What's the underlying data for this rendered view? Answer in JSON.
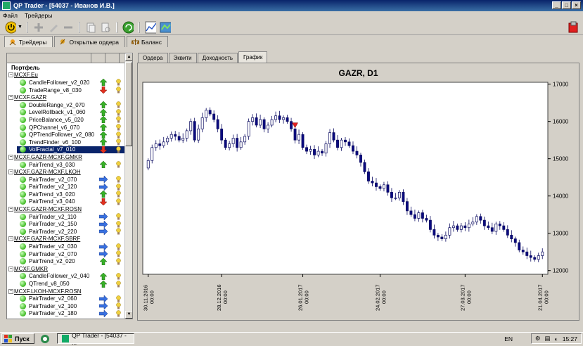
{
  "window": {
    "title": "QP Trader - [54037 - Иванов И.В.]"
  },
  "menu": [
    "Файл",
    "Трейдеры"
  ],
  "main_tabs": [
    {
      "label": "Трейдеры"
    },
    {
      "label": "Открытые ордера"
    },
    {
      "label": "Баланс"
    }
  ],
  "tree": [
    {
      "type": "root",
      "name": "Портфель"
    },
    {
      "type": "group",
      "name": "MCXF.Eu"
    },
    {
      "type": "item",
      "name": "CandleFollower_v2_020",
      "dir": "up"
    },
    {
      "type": "item",
      "name": "TradeRange_v8_030",
      "dir": "down"
    },
    {
      "type": "group",
      "name": "MCXF.GAZR"
    },
    {
      "type": "item",
      "name": "DoubleRange_v2_070",
      "dir": "up"
    },
    {
      "type": "item",
      "name": "LevelRollback_v1_060",
      "dir": "up"
    },
    {
      "type": "item",
      "name": "PriceBalance_v5_020",
      "dir": "up"
    },
    {
      "type": "item",
      "name": "QPChannel_v6_070",
      "dir": "up"
    },
    {
      "type": "item",
      "name": "QPTrendFollower_v2_080",
      "dir": "up"
    },
    {
      "type": "item",
      "name": "TrendFinder_v6_100",
      "dir": "up"
    },
    {
      "type": "item",
      "name": "VolFractal_v7_010",
      "dir": "down",
      "selected": true
    },
    {
      "type": "group",
      "name": "MCXF.GAZR-MCXF.GMKR"
    },
    {
      "type": "item",
      "name": "PairTrend_v3_030",
      "dir": "up"
    },
    {
      "type": "group",
      "name": "MCXF.GAZR-MCXF.LKOH"
    },
    {
      "type": "item",
      "name": "PairTrader_v2_070",
      "dir": "right"
    },
    {
      "type": "item",
      "name": "PairTrader_v2_120",
      "dir": "right"
    },
    {
      "type": "item",
      "name": "PairTrend_v3_020",
      "dir": "up"
    },
    {
      "type": "item",
      "name": "PairTrend_v3_040",
      "dir": "down"
    },
    {
      "type": "group",
      "name": "MCXF.GAZR-MCXF.ROSN"
    },
    {
      "type": "item",
      "name": "PairTrader_v2_110",
      "dir": "right"
    },
    {
      "type": "item",
      "name": "PairTrader_v2_150",
      "dir": "right"
    },
    {
      "type": "item",
      "name": "PairTrader_v2_220",
      "dir": "right"
    },
    {
      "type": "group",
      "name": "MCXF.GAZR-MCXF.SBRF"
    },
    {
      "type": "item",
      "name": "PairTrader_v2_030",
      "dir": "right"
    },
    {
      "type": "item",
      "name": "PairTrader_v2_070",
      "dir": "right"
    },
    {
      "type": "item",
      "name": "PairTrend_v2_020",
      "dir": "up"
    },
    {
      "type": "group",
      "name": "MCXF.GMKR"
    },
    {
      "type": "item",
      "name": "CandleFollower_v2_040",
      "dir": "up"
    },
    {
      "type": "item",
      "name": "QTrend_v8_050",
      "dir": "up"
    },
    {
      "type": "group",
      "name": "MCXF.LKOH-MCXF.ROSN"
    },
    {
      "type": "item",
      "name": "PairTrader_v2_060",
      "dir": "right"
    },
    {
      "type": "item",
      "name": "PairTrader_v2_100",
      "dir": "right"
    },
    {
      "type": "item",
      "name": "PairTrader_v2_180",
      "dir": "right"
    }
  ],
  "sub_tabs": [
    {
      "label": "Ордера"
    },
    {
      "label": "Эквити"
    },
    {
      "label": "Доходность"
    },
    {
      "label": "График",
      "active": true
    }
  ],
  "chart_data": {
    "type": "candlestick",
    "title": "GAZR, D1",
    "yticks": [
      12000,
      13000,
      14000,
      15000,
      16000,
      17000
    ],
    "ylim": [
      11900,
      17050
    ],
    "xticks": [
      "30.11.2016 00:00",
      "28.12.2016 00:00",
      "26.01.2017 00:00",
      "24.02.2017 00:00",
      "27.03.2017 00:00",
      "21.04.2017 00:00"
    ],
    "close": [
      14950,
      15300,
      15400,
      15350,
      15450,
      15550,
      15650,
      15600,
      15500,
      15550,
      15750,
      16000,
      15500,
      15800,
      16100,
      16300,
      16200,
      16050,
      15800,
      15500,
      15300,
      15400,
      15550,
      15300,
      15450,
      15600,
      16000,
      16100,
      15900,
      16050,
      15800,
      15900,
      16050,
      16150,
      16050,
      16100,
      16000,
      15800,
      15500,
      15650,
      15300,
      15200,
      15250,
      15100,
      15200,
      15150,
      15400,
      15700,
      15500,
      15300,
      15500,
      15450,
      15350,
      15200,
      15100,
      14900,
      14650,
      14400,
      14350,
      14250,
      14200,
      14300,
      14100,
      13950,
      13950,
      14100,
      13850,
      13600,
      13500,
      13400,
      13550,
      13400,
      13350,
      13100,
      12950,
      12900,
      12850,
      12950,
      13150,
      13200,
      13100,
      13200,
      13150,
      13250,
      13300,
      13450,
      13350,
      13200,
      13150,
      13050,
      13250,
      13200,
      13100,
      12950,
      12850,
      12750,
      12550,
      12500,
      12400,
      12350,
      12300,
      12400,
      12500
    ],
    "signal": {
      "index": 38,
      "direction": "down"
    }
  },
  "taskbar": {
    "start": "Пуск",
    "task": "QP Trader - [54037 - ...",
    "lang": "EN",
    "time": "15:27"
  }
}
